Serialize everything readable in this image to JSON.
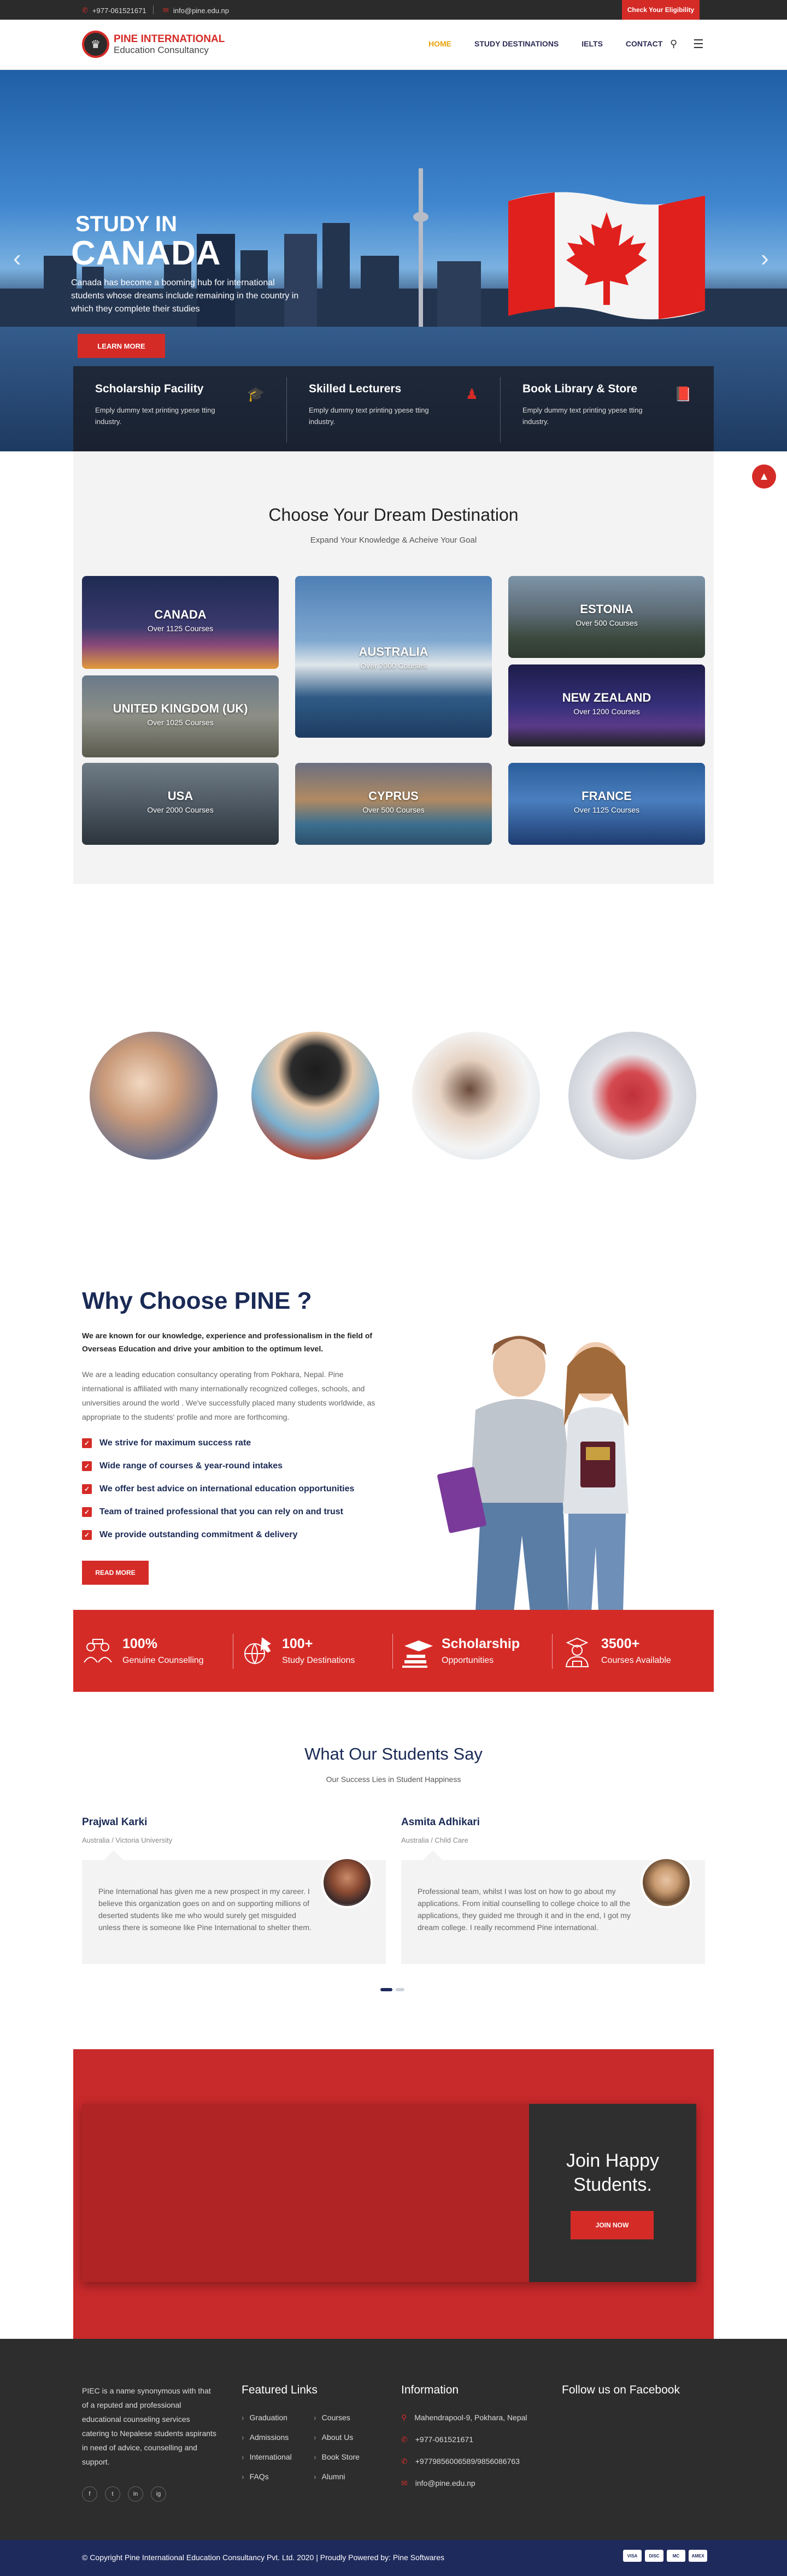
{
  "topbar": {
    "phone": "+977-061521671",
    "email": "info@pine.edu.np",
    "eligibility_button": "Check Your Eligibility"
  },
  "header": {
    "logo_line1": "PINE INTERNATIONAL",
    "logo_line2": "Education Consultancy",
    "nav": [
      "HOME",
      "STUDY DESTINATIONS",
      "IELTS",
      "CONTACT"
    ],
    "active_nav": "HOME",
    "icons": [
      "search-icon",
      "menu-icon"
    ]
  },
  "hero": {
    "study_in": "STUDY IN",
    "country": "CANADA",
    "description": "Canada has become a booming hub for international students whose dreams include remaining in the country in which they complete their studies",
    "button": "LEARN MORE"
  },
  "features": [
    {
      "title": "Scholarship Facility",
      "desc": "Emply dummy text printing ypese tting industry.",
      "icon": "graduation-cap-icon"
    },
    {
      "title": "Skilled Lecturers",
      "desc": "Emply dummy text printing ypese tting industry.",
      "icon": "user-icon"
    },
    {
      "title": "Book Library & Store",
      "desc": "Emply dummy text printing ypese tting industry.",
      "icon": "book-icon"
    }
  ],
  "destinations": {
    "title": "Choose Your Dream Destination",
    "subtitle": "Expand Your Knowledge & Acheive Your Goal",
    "items": [
      {
        "name": "CANADA",
        "count": "Over 1125 Courses"
      },
      {
        "name": "AUSTRALIA",
        "count": "Over 2000 Courses"
      },
      {
        "name": "ESTONIA",
        "count": "Over 500 Courses"
      },
      {
        "name": "UNITED KINGDOM (UK)",
        "count": "Over 1025 Courses"
      },
      {
        "name": "NEW ZEALAND",
        "count": "Over 1200 Courses"
      },
      {
        "name": "USA",
        "count": "Over 2000 Courses"
      },
      {
        "name": "CYPRUS",
        "count": "Over 500 Courses"
      },
      {
        "name": "FRANCE",
        "count": "Over 1125 Courses"
      }
    ]
  },
  "why": {
    "title": "Why Choose PINE ?",
    "lead": "We are known for our knowledge, experience and professionalism in the field of Overseas Education and drive your ambition to the optimum level.",
    "body": "We are a leading education consultancy operating from Pokhara, Nepal. Pine international is affiliated with many internationally recognized colleges, schools, and universities around the world . We've successfully placed many students worldwide, as appropriate to the students' profile and more are forthcoming.",
    "list": [
      "We strive for maximum success rate",
      "Wide range of courses & year-round intakes",
      "We  offer best advice on international education opportunities",
      "Team of trained professional that you can rely on and trust",
      "We provide outstanding commitment & delivery"
    ],
    "button": "READ MORE"
  },
  "stats": [
    {
      "value": "100%",
      "label": "Genuine Counselling",
      "icon": "counselling-icon"
    },
    {
      "value": "100+",
      "label": "Study Destinations",
      "icon": "globe-plane-icon"
    },
    {
      "value": "Scholarship",
      "label": "Opportunities",
      "icon": "scholarship-icon"
    },
    {
      "value": "3500+",
      "label": "Courses Available",
      "icon": "student-icon"
    }
  ],
  "testimonials": {
    "title": "What Our Students Say",
    "subtitle": "Our Success Lies in Student Happiness",
    "items": [
      {
        "name": "Prajwal Karki",
        "role": "Australia / Victoria University",
        "text": "Pine International has given me a new prospect in my career. I believe this organization goes on and on supporting millions of deserted students like me who would surely get misguided unless there is someone like Pine International to shelter them."
      },
      {
        "name": "Asmita Adhikari",
        "role": "Australia / Child Care",
        "text": "Professional team, whilst I was lost on how to go about my applications. From initial counselling to college choice to all the applications, they guided me through it and in the end, I got my dream college. I really recommend Pine international."
      }
    ]
  },
  "join": {
    "title": "Join Happy Students.",
    "button": "JOIN NOW"
  },
  "footer": {
    "about": "PIEC is a name synonymous with that of a reputed and professional educational counseling services catering to Nepalese students aspirants in need of advice, counselling and support.",
    "social": [
      "f",
      "t",
      "in",
      "ig"
    ],
    "featured_title": "Featured Links",
    "featured_col1": [
      "Graduation",
      "Admissions",
      "International",
      "FAQs"
    ],
    "featured_col2": [
      "Courses",
      "About Us",
      "Book Store",
      "Alumni"
    ],
    "info_title": "Information",
    "info": [
      "Mahendrapool-9, Pokhara, Nepal",
      "+977-061521671",
      "+9779856006589/9856086763",
      "info@pine.edu.np"
    ],
    "facebook_title": "Follow us on Facebook",
    "copyright": "© Copyright Pine International Education Consultancy Pvt. Ltd. 2020 | Proudly Powered by: Pine Softwares",
    "payments": [
      "VISA",
      "DISC",
      "MC",
      "AMEX"
    ]
  }
}
